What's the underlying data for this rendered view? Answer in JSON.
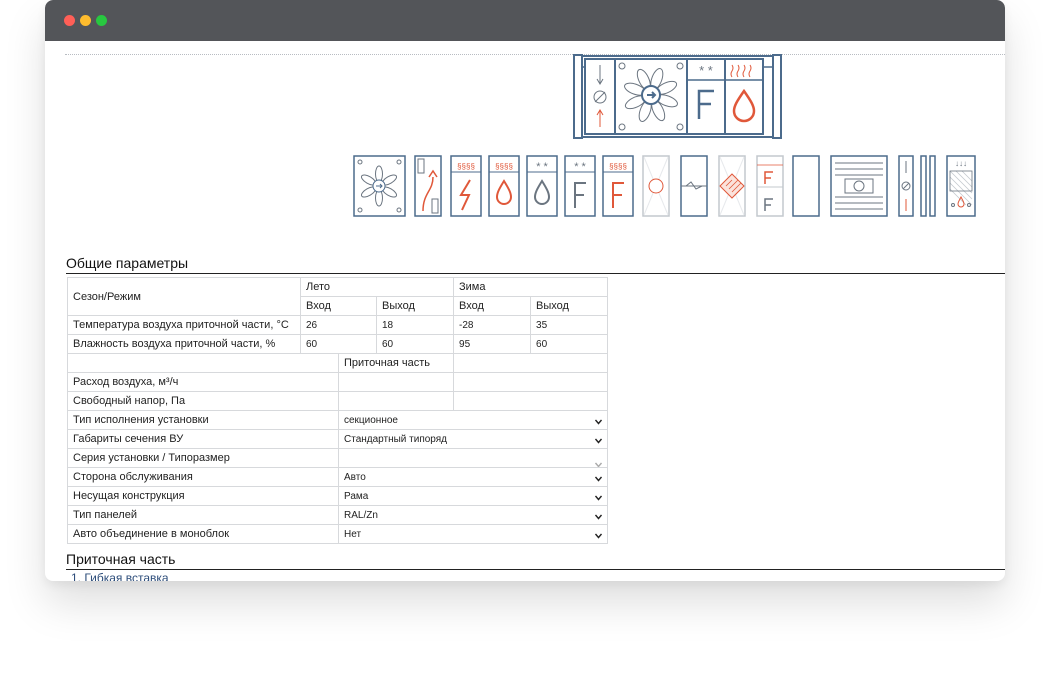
{
  "section_general": "Общие параметры",
  "section_supply": "Приточная часть",
  "next_item_label": "1. Гибкая вставка",
  "season_table": {
    "season_label": "Сезон/Режим",
    "summer": "Лето",
    "winter": "Зима",
    "inlet": "Вход",
    "outlet": "Выход",
    "rows": [
      {
        "label": "Температура воздуха приточной части, °С",
        "summer_in": "26",
        "summer_out": "18",
        "winter_in": "-28",
        "winter_out": "35"
      },
      {
        "label": "Влажность воздуха приточной части, %",
        "summer_in": "60",
        "summer_out": "60",
        "winter_in": "95",
        "winter_out": "60"
      }
    ]
  },
  "supply_header": "Приточная часть",
  "airflow": {
    "label": "Расход воздуха, м³/ч",
    "value": ""
  },
  "pressure": {
    "label": "Свободный напор, Па",
    "value": ""
  },
  "settings": [
    {
      "label": "Тип исполнения установки",
      "value": "секционное",
      "disabled": false
    },
    {
      "label": "Габариты сечения ВУ",
      "value": "Стандартный типоряд",
      "disabled": false
    },
    {
      "label": "Серия установки / Типоразмер",
      "value": "",
      "disabled": true
    },
    {
      "label": "Сторона обслуживания",
      "value": "Авто",
      "disabled": false
    },
    {
      "label": "Несущая конструкция",
      "value": "Рама",
      "disabled": false
    },
    {
      "label": "Тип панелей",
      "value": "RAL/Zn",
      "disabled": false
    },
    {
      "label": "Авто объединение в моноблок",
      "value": "Нет",
      "disabled": false
    }
  ],
  "assembled_unit": [
    "damper",
    "fan",
    "cooler-filter",
    "heater-humidifier"
  ],
  "palette": [
    "fan-module",
    "recuperator-module",
    "electric-heater-module",
    "water-heater-module",
    "humidifier-module",
    "cooler-filter-module",
    "heater-filter-module",
    "rotary-recuperator-module",
    "mixing-chamber-module",
    "plate-recuperator-module",
    "double-filter-module",
    "empty-module",
    "silencer-module",
    "air-valve-module",
    "flexible-insert-module",
    "drop-eliminator-module"
  ],
  "colors": {
    "titlebar": "#535559",
    "accent_orange": "#e0583a",
    "frame_blue": "#4c6b8c",
    "icon_gray": "#6b7580"
  }
}
